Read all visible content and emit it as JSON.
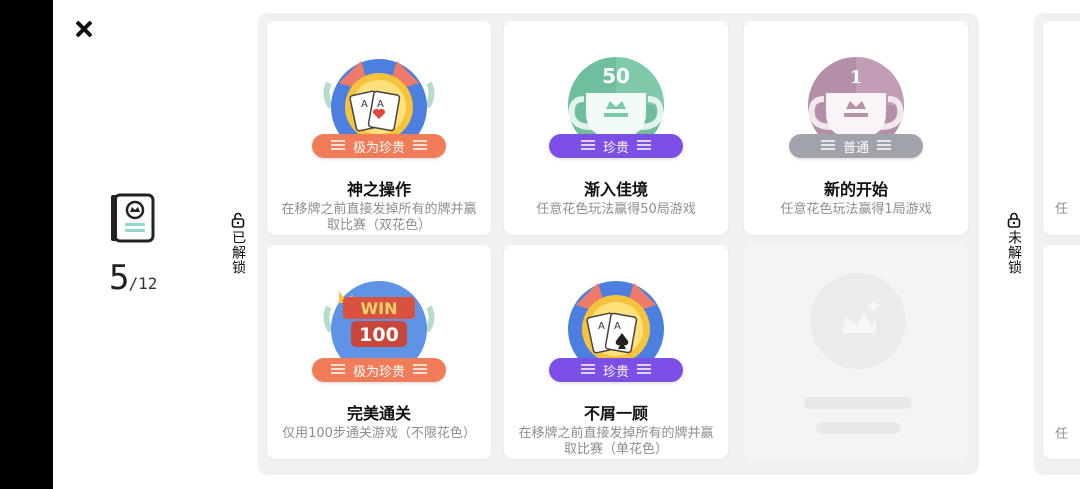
{
  "header": {
    "close_icon": "close-icon"
  },
  "progress": {
    "unlocked": "5",
    "total": "/12"
  },
  "sections": {
    "unlocked_label": "已解锁",
    "locked_label": "未解锁"
  },
  "cards": [
    {
      "title": "神之操作",
      "desc": "在移牌之前直接发掉所有的牌并赢取比赛（双花色）",
      "rarity": "极为珍贵",
      "badge": "cards-medal-icon"
    },
    {
      "title": "渐入佳境",
      "desc": "任意花色玩法赢得50局游戏",
      "rarity": "珍贵",
      "badge": "trophy-50-icon",
      "number": "50"
    },
    {
      "title": "新的开始",
      "desc": "任意花色玩法赢得1局游戏",
      "rarity": "普通",
      "badge": "trophy-1-icon",
      "number": "1"
    },
    {
      "title": "完美通关",
      "desc": "仅用100步通关游戏（不限花色）",
      "rarity": "极为珍贵",
      "badge": "win-100-icon",
      "win": "WIN",
      "number": "100"
    },
    {
      "title": "不屑一顾",
      "desc": "在移牌之前直接发掉所有的牌并赢取比赛（单花色）",
      "rarity": "珍贵",
      "badge": "spade-medal-icon"
    }
  ],
  "locked_cards": [
    {
      "desc": "任"
    },
    {
      "desc": "任"
    }
  ]
}
